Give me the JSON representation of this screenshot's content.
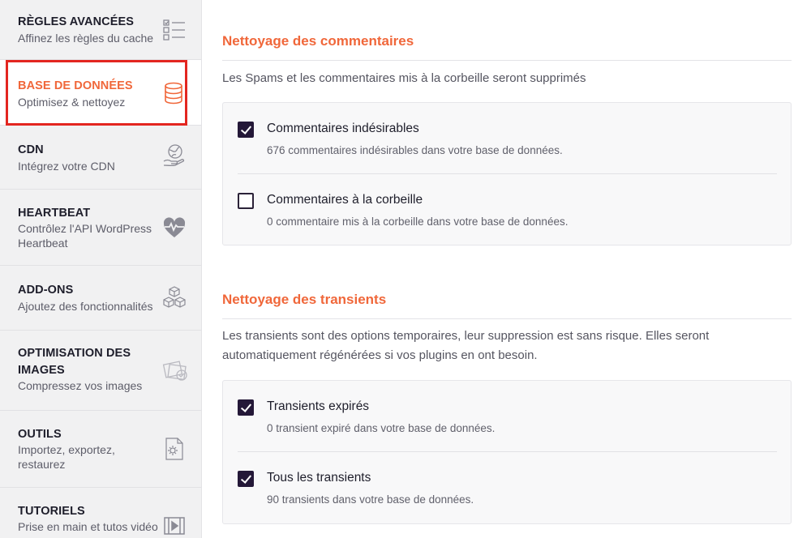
{
  "sidebar": {
    "items": [
      {
        "title": "RÈGLES AVANCÉES",
        "subtitle": "Affinez les règles du cache",
        "icon": "list-checks-icon"
      },
      {
        "title": "BASE DE DONNÉES",
        "subtitle": "Optimisez & nettoyez",
        "icon": "database-icon",
        "active": true
      },
      {
        "title": "CDN",
        "subtitle": "Intégrez votre CDN",
        "icon": "globe-hand-icon"
      },
      {
        "title": "HEARTBEAT",
        "subtitle": "Contrôlez l'API WordPress Heartbeat",
        "icon": "heartbeat-icon"
      },
      {
        "title": "ADD-ONS",
        "subtitle": "Ajoutez des fonctionnalités",
        "icon": "cubes-icon"
      },
      {
        "title": "OPTIMISATION DES IMAGES",
        "subtitle": "Compressez vos images",
        "icon": "images-icon"
      },
      {
        "title": "OUTILS",
        "subtitle": "Importez, exportez, restaurez",
        "icon": "file-gear-icon"
      },
      {
        "title": "TUTORIELS",
        "subtitle": "Prise en main et tutos vidéo",
        "icon": "video-icon"
      }
    ]
  },
  "comments_section": {
    "title": "Nettoyage des commentaires",
    "description": "Les Spams et les commentaires mis à la corbeille seront supprimés",
    "options": [
      {
        "label": "Commentaires indésirables",
        "description": "676 commentaires indésirables dans votre base de données.",
        "checked": true
      },
      {
        "label": "Commentaires à la corbeille",
        "description": "0 commentaire mis à la corbeille dans votre base de données.",
        "checked": false
      }
    ]
  },
  "transients_section": {
    "title": "Nettoyage des transients",
    "description": "Les transients sont des options temporaires, leur suppression est sans risque. Elles seront automatiquement régénérées si vos plugins en ont besoin.",
    "options": [
      {
        "label": "Transients expirés",
        "description": "0 transient expiré dans votre base de données.",
        "checked": true
      },
      {
        "label": "Tous les transients",
        "description": "90 transients dans votre base de données.",
        "checked": true
      }
    ]
  },
  "colors": {
    "accent": "#f0673a",
    "highlight_frame": "#e32620",
    "checkbox_checked": "#241838"
  }
}
